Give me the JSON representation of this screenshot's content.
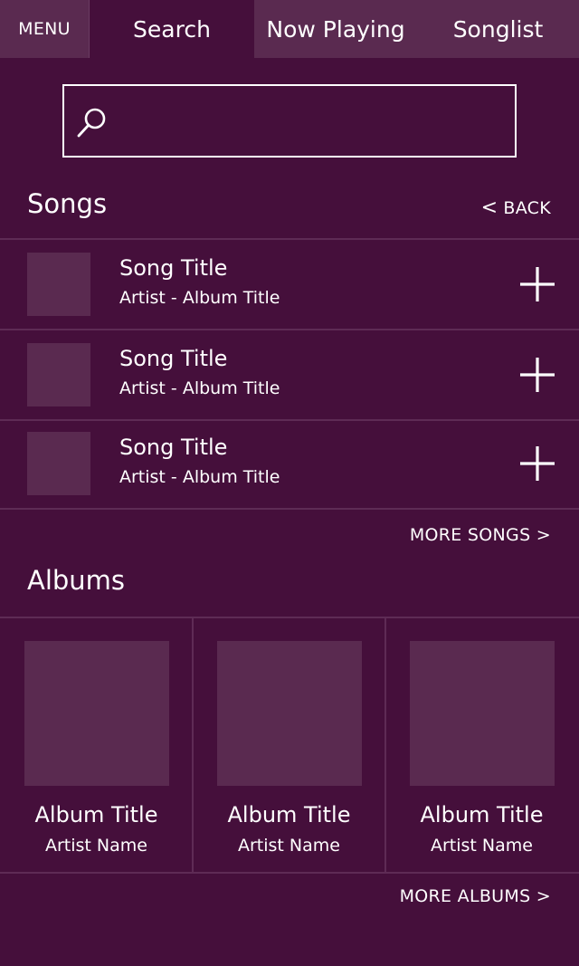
{
  "nav": {
    "menu_label": "MENU",
    "tabs": [
      {
        "label": "Search"
      },
      {
        "label": "Now Playing"
      },
      {
        "label": "Songlist"
      }
    ]
  },
  "search": {
    "value": "",
    "placeholder": ""
  },
  "songs_section": {
    "title": "Songs",
    "back_label": "BACK",
    "items": [
      {
        "title": "Song Title",
        "subtitle": "Artist - Album Title"
      },
      {
        "title": "Song Title",
        "subtitle": "Artist - Album Title"
      },
      {
        "title": "Song Title",
        "subtitle": "Artist - Album Title"
      }
    ],
    "more_label": "MORE SONGS >"
  },
  "albums_section": {
    "title": "Albums",
    "items": [
      {
        "title": "Album Title",
        "artist": "Artist Name"
      },
      {
        "title": "Album Title",
        "artist": "Artist Name"
      },
      {
        "title": "Album Title",
        "artist": "Artist Name"
      }
    ],
    "more_label": "MORE ALBUMS >"
  },
  "colors": {
    "background": "#450f3b",
    "nav_background": "#5a2a50",
    "placeholder_tile": "#5a2a50",
    "divider": "#5e2b55",
    "text": "#ffffff"
  },
  "icons": {
    "search": "search-icon",
    "add": "plus-icon",
    "back": "chevron-left-icon"
  }
}
